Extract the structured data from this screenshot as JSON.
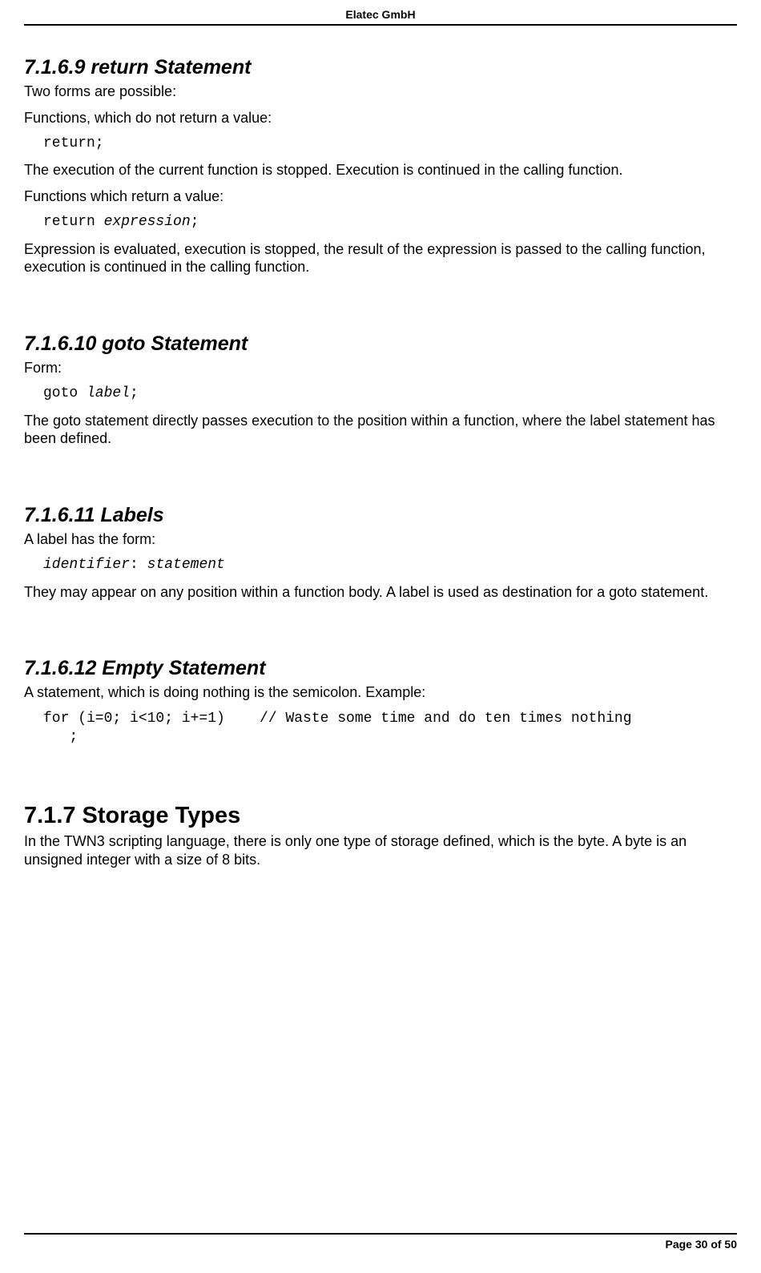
{
  "header": {
    "company": "Elatec GmbH"
  },
  "sections": {
    "s1": {
      "heading": "7.1.6.9  return Statement",
      "p1": "Two forms are possible:",
      "p2": "Functions, which do not return a value:",
      "code1": "return;",
      "p3": "The execution of the current function is stopped. Execution is continued in the calling function.",
      "p4": "Functions which return a value:",
      "code2a": "return ",
      "code2b": "expression",
      "code2c": ";",
      "p5": "Expression is evaluated, execution is stopped, the result of the expression is passed to the calling function, execution is continued in the calling function."
    },
    "s2": {
      "heading": "7.1.6.10  goto Statement",
      "p1": "Form:",
      "code1a": "goto ",
      "code1b": "label",
      "code1c": ";",
      "p2": "The goto statement directly passes execution to the position within a function, where the label statement has been defined."
    },
    "s3": {
      "heading": "7.1.6.11  Labels",
      "p1": "A label has the form:",
      "code1a": "identifier",
      "code1b": ": ",
      "code1c": "statement",
      "p2": "They may appear on any position within a function body. A label is used as destination for a goto statement."
    },
    "s4": {
      "heading": "7.1.6.12  Empty Statement",
      "p1": "A statement, which is doing nothing is the semicolon. Example:",
      "code1": "for (i=0; i<10; i+=1)    // Waste some time and do ten times nothing\n   ;"
    },
    "s5": {
      "heading": "7.1.7  Storage Types",
      "p1": "In the TWN3 scripting language, there is only one type of storage defined, which is the byte. A byte is an unsigned integer with a size of 8 bits."
    }
  },
  "footer": {
    "page": "Page 30 of 50"
  }
}
